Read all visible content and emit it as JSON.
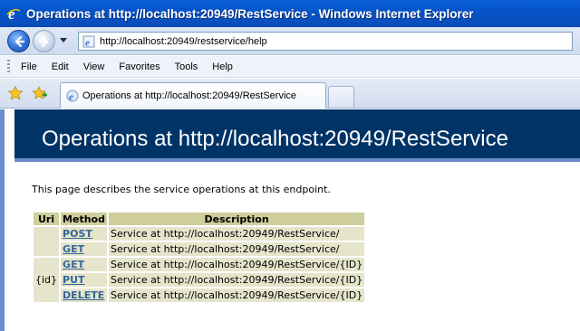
{
  "window": {
    "title": "Operations at http://localhost:20949/RestService - Windows Internet Explorer"
  },
  "address_bar": {
    "url": "http://localhost:20949/restservice/help"
  },
  "menu": {
    "items": [
      "File",
      "Edit",
      "View",
      "Favorites",
      "Tools",
      "Help"
    ]
  },
  "tabs": {
    "active_label": "Operations at http://localhost:20949/RestService"
  },
  "page": {
    "heading": "Operations at http://localhost:20949/RestService",
    "intro": "This page describes the service operations at this endpoint.",
    "table": {
      "headers": [
        "Uri",
        "Method",
        "Description"
      ],
      "rows": [
        {
          "uri": "",
          "method": "POST",
          "description": "Service at http://localhost:20949/RestService/"
        },
        {
          "uri": "",
          "method": "GET",
          "description": "Service at http://localhost:20949/RestService/"
        },
        {
          "uri": "{id}",
          "method": "GET",
          "description": "Service at http://localhost:20949/RestService/{ID}"
        },
        {
          "uri": "",
          "method": "PUT",
          "description": "Service at http://localhost:20949/RestService/{ID}"
        },
        {
          "uri": "",
          "method": "DELETE",
          "description": "Service at http://localhost:20949/RestService/{ID}"
        }
      ]
    }
  },
  "icons": {
    "title": "ie-logo-icon",
    "back": "back-arrow-icon",
    "forward": "forward-arrow-icon",
    "page": "ie-page-icon",
    "favorites": "favorites-star-icon",
    "add_favorite": "add-favorite-icon"
  },
  "colors": {
    "heading_bg": "#003366",
    "heading_border": "#6b8ccc",
    "table_header_bg": "#cecf9c",
    "table_cell_bg": "#e5e5cc",
    "method_link": "#336699"
  }
}
